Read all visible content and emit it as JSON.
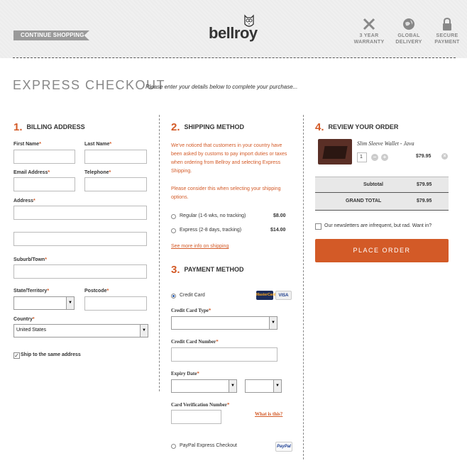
{
  "header": {
    "continue_label": "CONTINUE SHOPPING",
    "logo_text": "bellroy",
    "badges": [
      {
        "line1": "3 YEAR",
        "line2": "WARRANTY",
        "icon": "tools-icon"
      },
      {
        "line1": "GLOBAL",
        "line2": "DELIVERY",
        "icon": "globe-icon"
      },
      {
        "line1": "SECURE",
        "line2": "PAYMENT",
        "icon": "lock-icon"
      }
    ]
  },
  "page": {
    "title": "EXPRESS CHECKOUT",
    "subtitle": "Please enter your details below to complete your purchase..."
  },
  "billing": {
    "num": "1.",
    "heading": "BILLING ADDRESS",
    "first_name": "First Name",
    "last_name": "Last Name",
    "email": "Email Address",
    "telephone": "Telephone",
    "address": "Address",
    "suburb": "Suburb/Town",
    "state": "State/Territory",
    "postcode": "Postcode",
    "country": "Country",
    "country_value": "United States",
    "ship_same": "Ship to the same address",
    "req": "*"
  },
  "shipping": {
    "num": "2.",
    "heading": "SHIPPING METHOD",
    "notice1a": "We've noticed that customers in your country have",
    "notice1b": "been asked by customs to pay import duties or taxes",
    "notice1c": "when ordering from Bellroy and selecting Express",
    "notice1d": "Shipping.",
    "notice2a": "Please consider this when selecting your shipping",
    "notice2b": "options.",
    "options": [
      {
        "label": "Regular (1-6 wks, no tracking)",
        "price": "$8.00"
      },
      {
        "label": "Express (2-8 days, tracking)",
        "price": "$14.00"
      }
    ],
    "more_info": "See more info on shipping"
  },
  "payment": {
    "num": "3.",
    "heading": "PAYMENT METHOD",
    "credit_card": "Credit Card",
    "card_type": "Credit Card Type",
    "card_number": "Credit Card Number",
    "expiry": "Expiry Date",
    "cvn": "Card Verification Number",
    "what_is": "What is this?",
    "paypal": "PayPal Express Checkout",
    "mastercard": "MasterCard",
    "visa": "VISA",
    "paypal_logo": "PayPal"
  },
  "review": {
    "num": "4.",
    "heading": "REVIEW YOUR ORDER",
    "product_name": "Slim Sleeve Wallet - Java",
    "qty": "1",
    "price": "$79.95",
    "subtotal_label": "Subtotal",
    "subtotal_value": "$79.95",
    "grand_label": "GRAND TOTAL",
    "grand_value": "$79.95",
    "newsletter": "Our newsletters are infrequent, but rad. Want in?",
    "place_order": "PLACE ORDER"
  },
  "colors": {
    "accent": "#d35a27",
    "grey": "#9a9a9a"
  }
}
